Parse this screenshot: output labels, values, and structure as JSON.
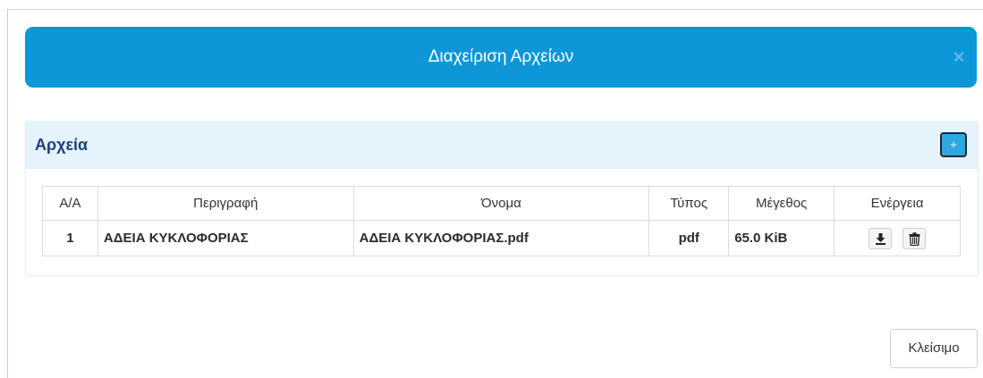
{
  "modal": {
    "title": "Διαχείριση Αρχείων",
    "close_symbol": "×"
  },
  "panel": {
    "title": "Αρχεία",
    "add_symbol": "+"
  },
  "table": {
    "headers": [
      "Α/Α",
      "Περιγραφή",
      "Όνομα",
      "Τύπος",
      "Μέγεθος",
      "Ενέργεια"
    ],
    "rows": [
      {
        "aa": "1",
        "description": "ΑΔΕΙΑ ΚΥΚΛΟΦΟΡΙΑΣ",
        "name": "ΑΔΕΙΑ ΚΥΚΛΟΦΟΡΙΑΣ.pdf",
        "type": "pdf",
        "size": "65.0 KiB",
        "actions": [
          "download-icon",
          "trash-icon"
        ]
      }
    ]
  },
  "footer": {
    "close_label": "Κλείσιμο"
  },
  "colors": {
    "header_blue": "#0d97d8",
    "panel_heading_bg": "#e4f3fc",
    "panel_title": "#1f3f7a"
  }
}
